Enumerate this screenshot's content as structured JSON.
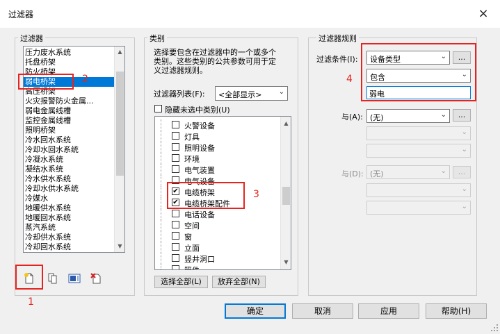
{
  "window": {
    "title": "过滤器",
    "close_glyph": "×"
  },
  "filters": {
    "group_label": "过滤器",
    "items": [
      "压力废水系统",
      "托盘桥架",
      "防火桥架",
      "弱电桥架",
      "高压桥架",
      "火灾报警防火金属...",
      "弱电金属线槽",
      "监控金属线槽",
      "照明桥架",
      "冷水回水系统",
      "冷却水回水系统",
      "冷凝水系统",
      "凝结水系统",
      "冷水供水系统",
      "冷却水供水系统",
      "冷媒水",
      "地暖供水系统",
      "地暖回水系统",
      "蒸汽系统",
      "冷却供水系统",
      "冷却回水系统"
    ],
    "selected": "弱电桥架"
  },
  "toolbar": {
    "icons": [
      "new-filter-icon",
      "duplicate-filter-icon",
      "rename-filter-icon",
      "delete-filter-icon"
    ]
  },
  "categories": {
    "group_label": "类别",
    "description": [
      "选择要包含在过滤器中的一个或多个",
      "类别。这些类别的公共参数可用于定",
      "义过滤器规则。"
    ],
    "list_label": "过滤器列表(F):",
    "list_value": "<全部显示>",
    "hide_unchecked_label": "隐藏未选中类别(U)",
    "items": [
      {
        "label": "火警设备",
        "checked": false
      },
      {
        "label": "灯具",
        "checked": false
      },
      {
        "label": "照明设备",
        "checked": false
      },
      {
        "label": "环境",
        "checked": false
      },
      {
        "label": "电气装置",
        "checked": false
      },
      {
        "label": "电气设备",
        "checked": false
      },
      {
        "label": "电缆桥架",
        "checked": true
      },
      {
        "label": "电缆桥架配件",
        "checked": true
      },
      {
        "label": "电话设备",
        "checked": false
      },
      {
        "label": "空间",
        "checked": false
      },
      {
        "label": "窗",
        "checked": false
      },
      {
        "label": "立面",
        "checked": false
      },
      {
        "label": "竖井洞口",
        "checked": false
      },
      {
        "label": "管件",
        "checked": false
      }
    ],
    "check_mark": "✔",
    "select_all": "选择全部(L)",
    "clear_all": "放弃全部(N)"
  },
  "rules": {
    "group_label": "过滤器规则",
    "condition_label": "过滤条件(I):",
    "condition_param": "设备类型",
    "condition_op": "包含",
    "condition_value": "弱电",
    "and1_label": "与(A):",
    "and1_value": "(无)",
    "and2_label": "与(D):",
    "and2_value": "(无)",
    "ellipsis": "..."
  },
  "buttons": {
    "ok": "确定",
    "cancel": "取消",
    "apply": "应用",
    "help": "帮助(H)"
  },
  "annotations": {
    "n1": "1",
    "n2": "2",
    "n3": "3",
    "n4": "4"
  },
  "colors": {
    "accent": "#0078d7",
    "annotation_red": "#e52420"
  }
}
